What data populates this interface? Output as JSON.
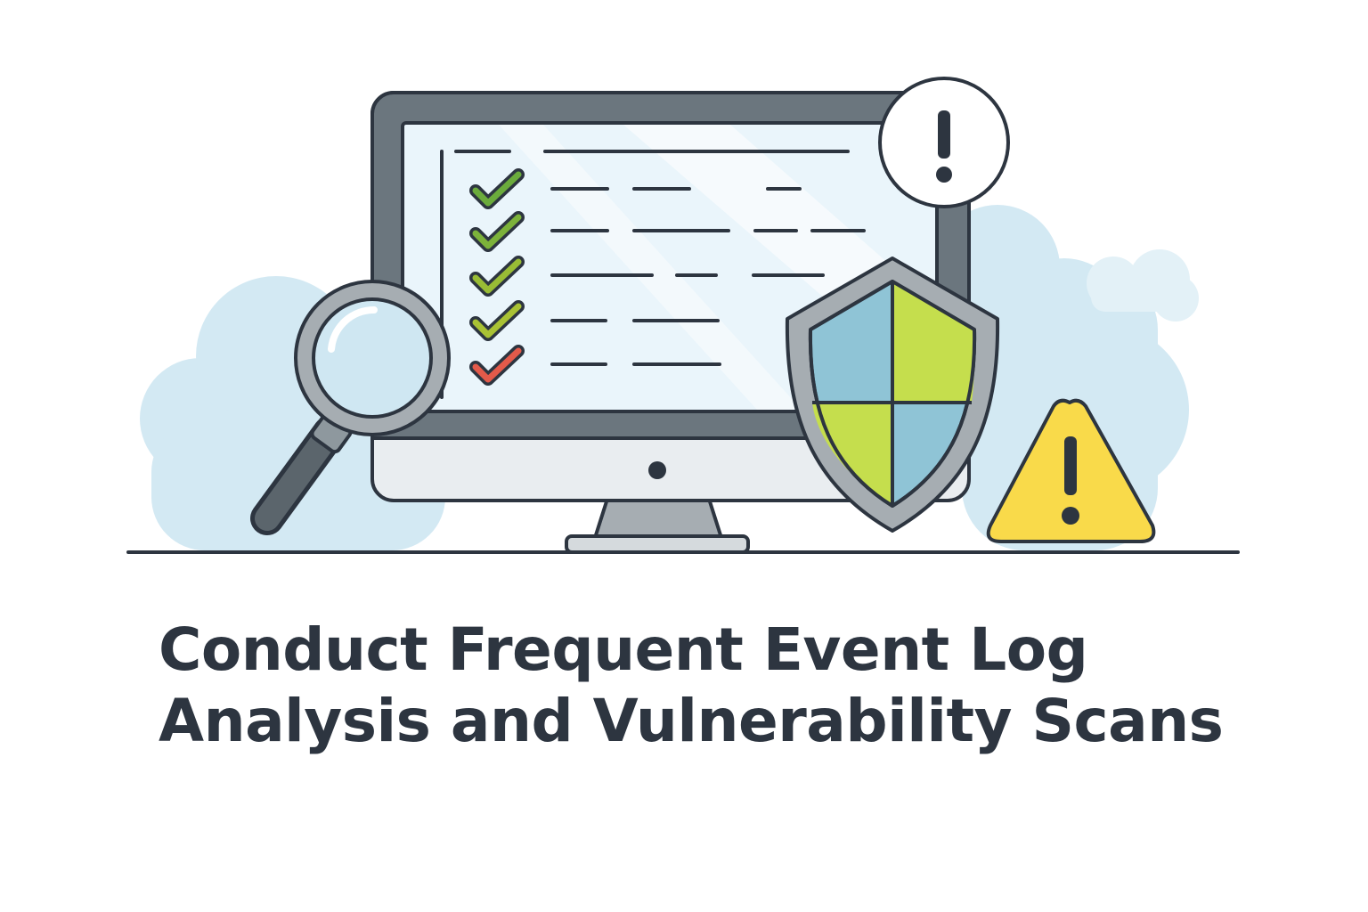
{
  "title": {
    "line1": "Conduct Frequent Event Log",
    "line2": "Analysis and Vulnerability Scans"
  },
  "colors": {
    "text": "#2d3540",
    "outline": "#2d3540",
    "monitor_frame": "#6b767e",
    "monitor_body": "#e9edf0",
    "screen": "#eaf5fb",
    "cloud": "#d3e9f3",
    "check_green": "#6bab3c",
    "check_lime": "#a9c234",
    "check_red": "#e35a4a",
    "shield_blue": "#8fc4d6",
    "shield_green": "#c5de4d",
    "warning_yellow": "#f9da4a"
  },
  "checklist": {
    "rows": [
      {
        "status": "pass",
        "icon": "check-icon"
      },
      {
        "status": "pass",
        "icon": "check-icon"
      },
      {
        "status": "pass",
        "icon": "check-icon"
      },
      {
        "status": "pass",
        "icon": "check-icon"
      },
      {
        "status": "fail",
        "icon": "check-icon"
      }
    ]
  },
  "icons": {
    "magnifier": "magnifying-glass-icon",
    "shield": "shield-icon",
    "alert_circle": "exclamation-circle-icon",
    "warning": "warning-triangle-icon"
  }
}
